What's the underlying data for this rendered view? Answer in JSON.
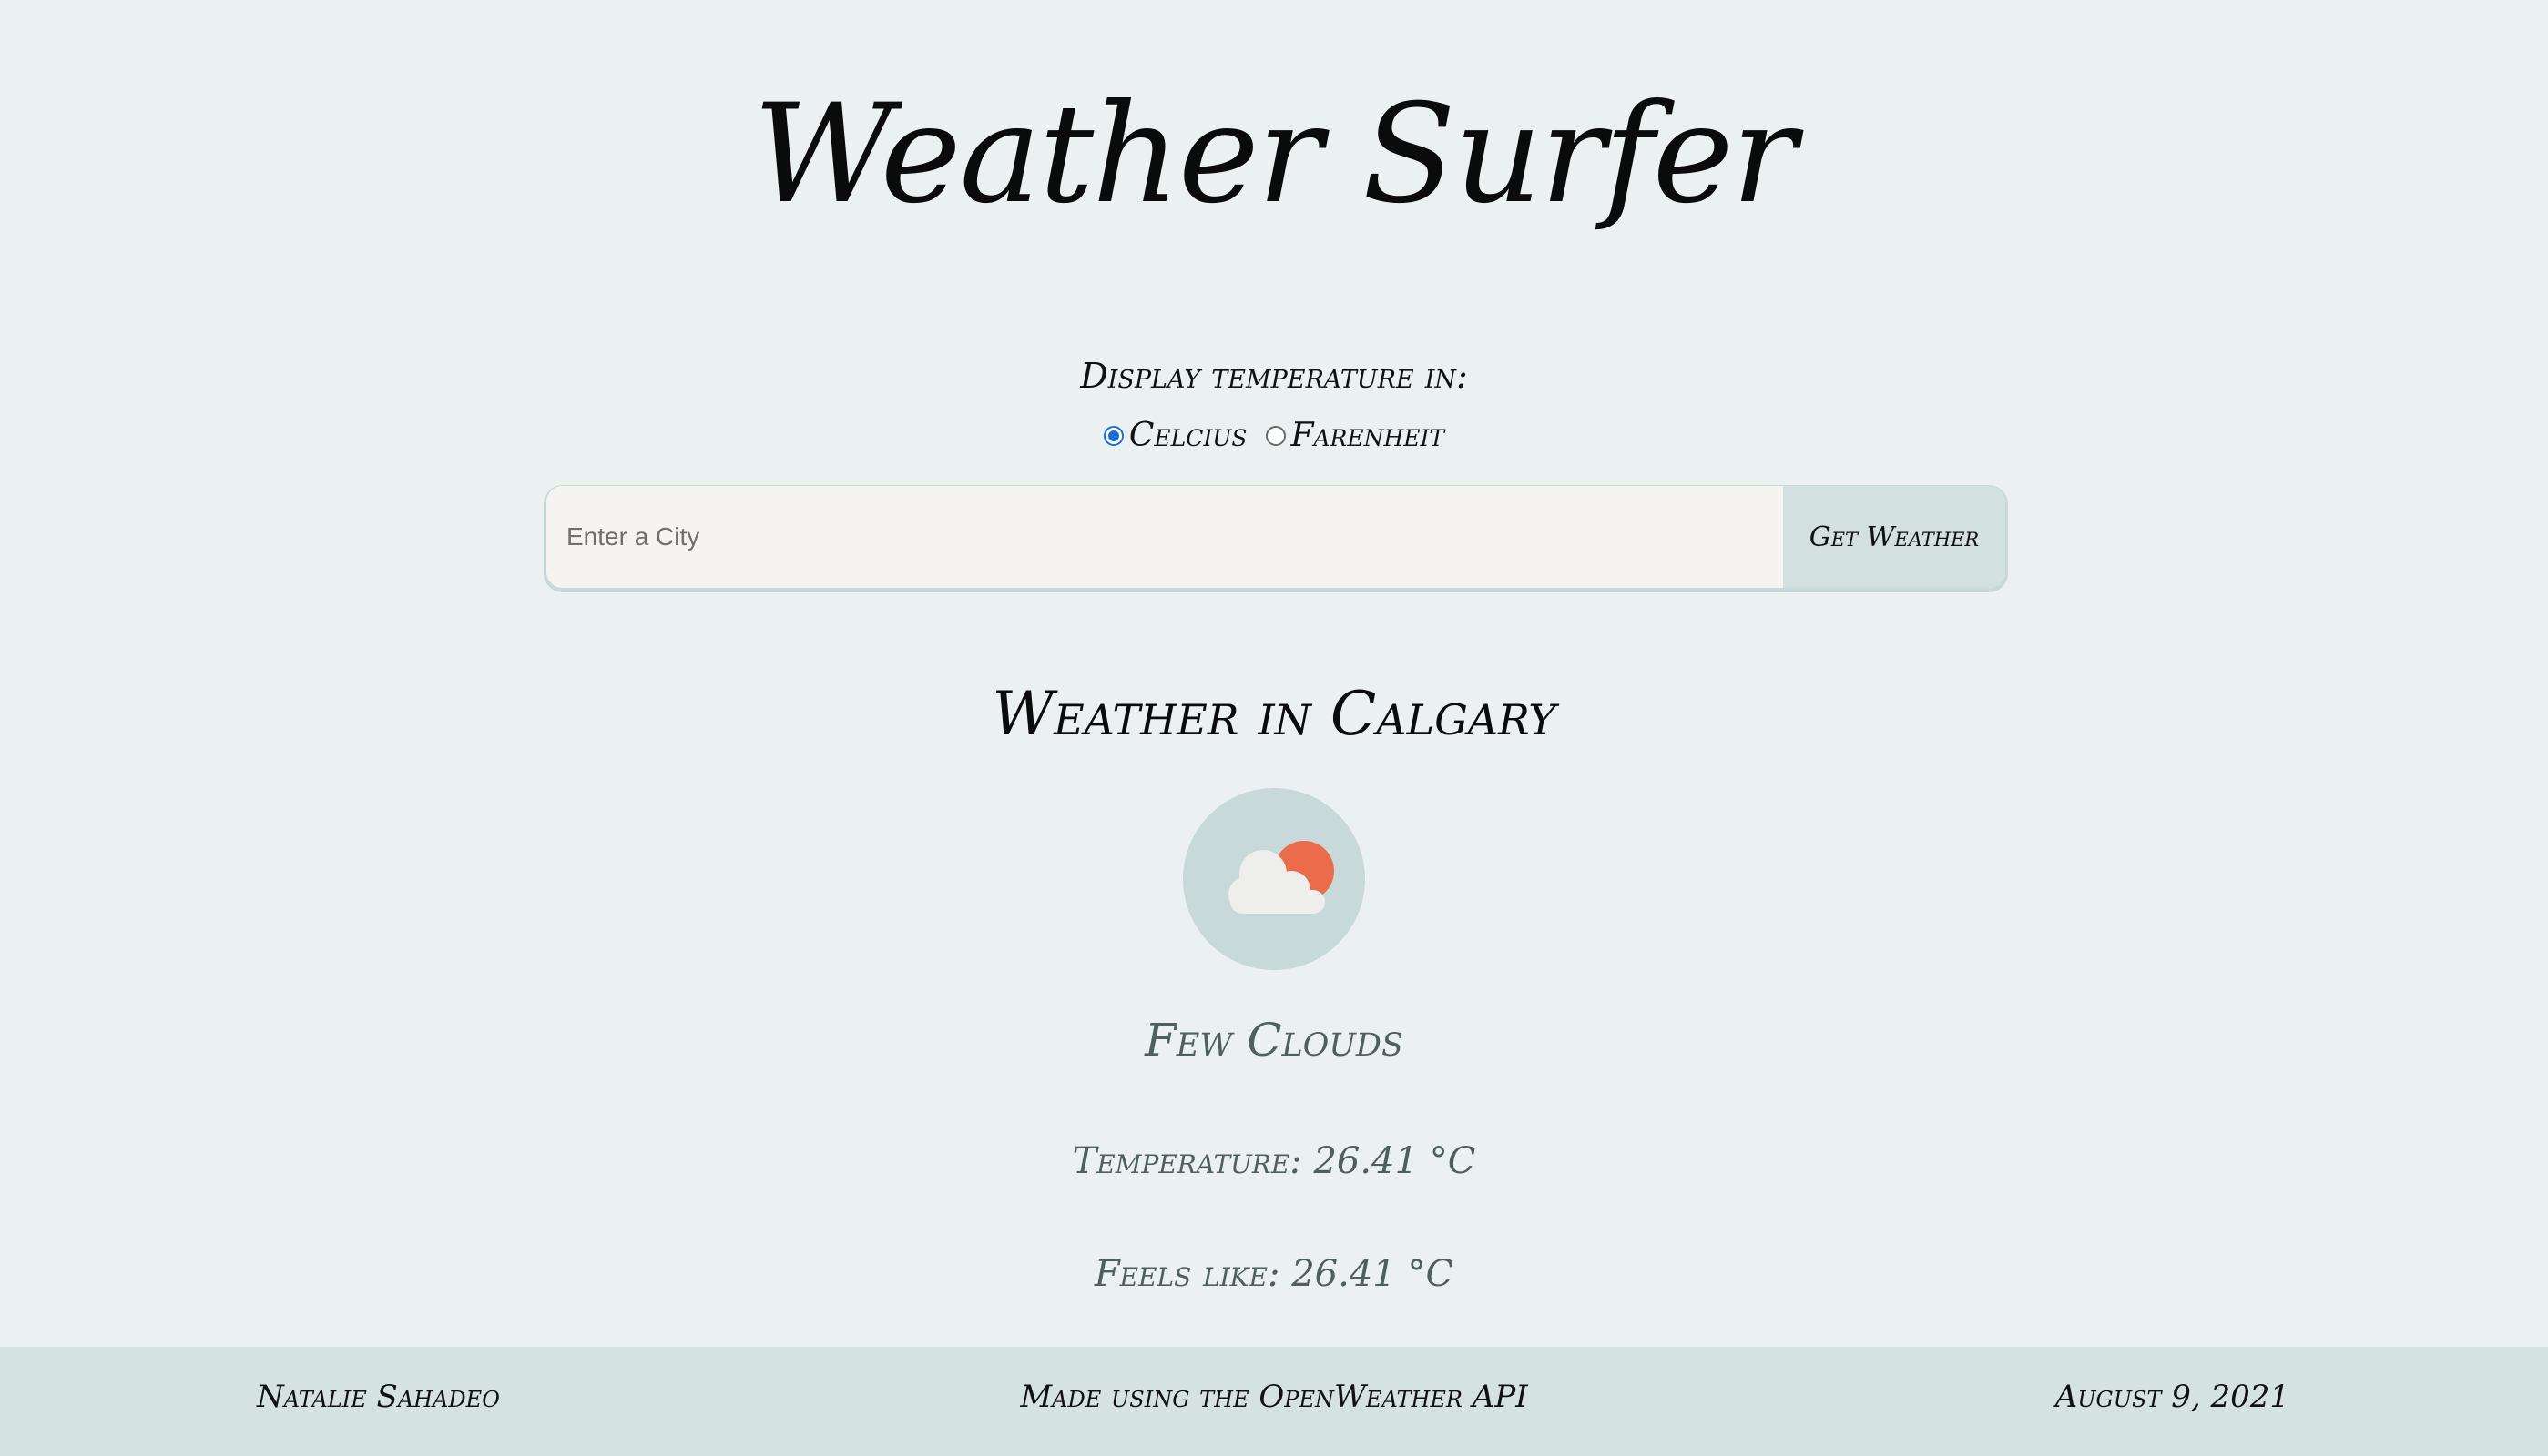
{
  "app": {
    "title": "Weather Surfer"
  },
  "units": {
    "prompt": "Display temperature in:",
    "options": [
      {
        "label": "Celcius",
        "selected": true
      },
      {
        "label": "Farenheit",
        "selected": false
      }
    ]
  },
  "search": {
    "placeholder": "Enter a City",
    "value": "",
    "button_label": "Get Weather"
  },
  "weather": {
    "heading": "Weather in Calgary",
    "icon": "few-clouds-icon",
    "description": "Few Clouds",
    "temperature": "Temperature: 26.41 °C",
    "feels_like": "Feels like: 26.41 °C"
  },
  "footer": {
    "author": "Natalie Sahadeo",
    "credit": "Made using the OpenWeather API",
    "date": "August 9, 2021"
  },
  "colors": {
    "background": "#ebf1f1",
    "footer": "#d4e2e2",
    "sun": "#ea6c4b",
    "cloud": "#eeeeec",
    "icon_circle": "#c8d9d9",
    "radio_accent": "#1a6ed8"
  }
}
